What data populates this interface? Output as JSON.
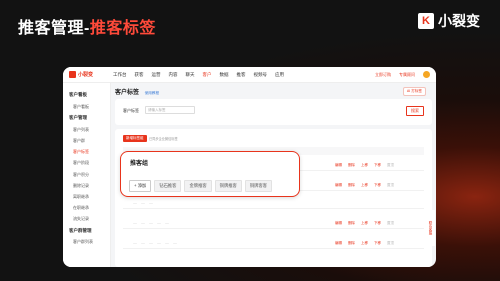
{
  "slide": {
    "title_prefix": "推客管理-",
    "title_highlight": "推客标签",
    "brand_mark": "K",
    "brand_name": "小裂变"
  },
  "app": {
    "logo": "小裂变",
    "nav": [
      "工作台",
      "获客",
      "运营",
      "内容",
      "聊天",
      "客户",
      "数据",
      "推客",
      "视频号",
      "应用"
    ],
    "active_nav": "客户",
    "right_link": "立即订购",
    "right_link2": "专属顾问"
  },
  "sidebar": {
    "groups": [
      {
        "label": "客户看板",
        "items": [
          "客户看板"
        ]
      },
      {
        "label": "客户管理",
        "items": [
          "客户列表",
          "客户群",
          "客户标签",
          "客户阶段",
          "客户积分",
          "删除记录",
          "离职继承",
          "在职继承",
          "流失记录"
        ]
      },
      {
        "label": "客户群管理",
        "items": [
          "客户群列表"
        ]
      }
    ],
    "active_item": "客户标签"
  },
  "main": {
    "page_title": "客户标签",
    "page_help": "使用教程",
    "ai_button": "AI 打标签",
    "filter_label": "客户标签",
    "filter_placeholder": "请输入标签",
    "search_button": "搜索",
    "new_group_button": "新增标签组",
    "hint": "已同步企业微信标签",
    "ops": [
      "编辑",
      "删除",
      "上移",
      "下移",
      "置顶"
    ],
    "rows": [
      {
        "name": "",
        "tags": [
          "",
          "",
          ""
        ]
      },
      {
        "name": "",
        "tags": [
          "",
          "",
          "",
          "",
          ""
        ]
      },
      {
        "name": "",
        "tags": [
          "",
          "",
          "",
          "",
          "",
          ""
        ]
      }
    ]
  },
  "callout": {
    "title": "推客组",
    "tags": [
      "+ 添加",
      "钻石推客",
      "金牌推客",
      "铜牌推客",
      "铜牌客客"
    ]
  },
  "float_tab": "联系客服"
}
